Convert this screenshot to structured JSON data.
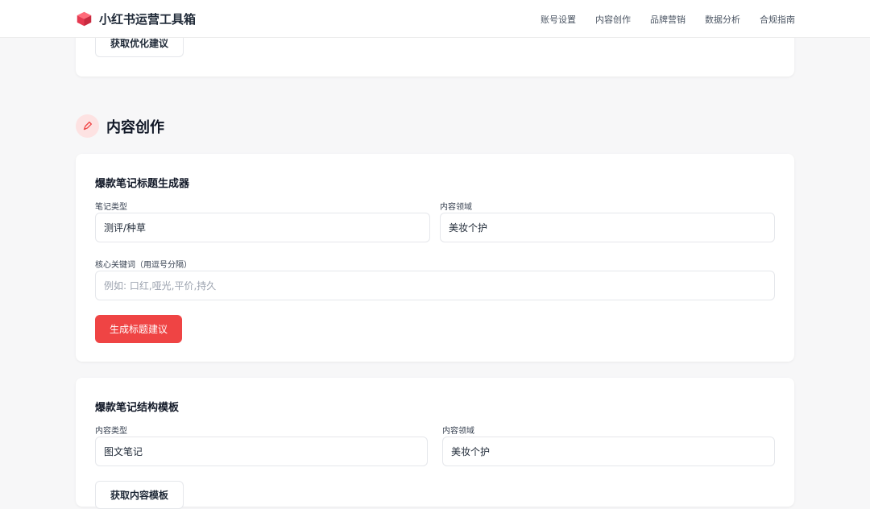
{
  "app": {
    "title": "小红书运营工具箱"
  },
  "nav": [
    {
      "label": "账号设置"
    },
    {
      "label": "内容创作"
    },
    {
      "label": "品牌营销"
    },
    {
      "label": "数据分析"
    },
    {
      "label": "合规指南"
    }
  ],
  "top_card": {
    "button_label": "获取优化建议"
  },
  "section": {
    "title": "内容创作",
    "icon": "pen-icon"
  },
  "title_generator": {
    "title": "爆款笔记标题生成器",
    "note_type_label": "笔记类型",
    "note_type_value": "测评/种草",
    "domain_label": "内容领域",
    "domain_value": "美妆个护",
    "keywords_label": "核心关键词（用逗号分隔）",
    "keywords_placeholder": "例如: 口红,哑光,平价,持久",
    "generate_label": "生成标题建议"
  },
  "structure_template": {
    "title": "爆款笔记结构模板",
    "content_type_label": "内容类型",
    "content_type_value": "图文笔记",
    "domain_label": "内容领域",
    "domain_value": "美妆个护",
    "button_label": "获取内容模板"
  },
  "colors": {
    "accent": "#ef4444",
    "accent_soft": "#fde2e2",
    "background": "#f7f7f8"
  }
}
